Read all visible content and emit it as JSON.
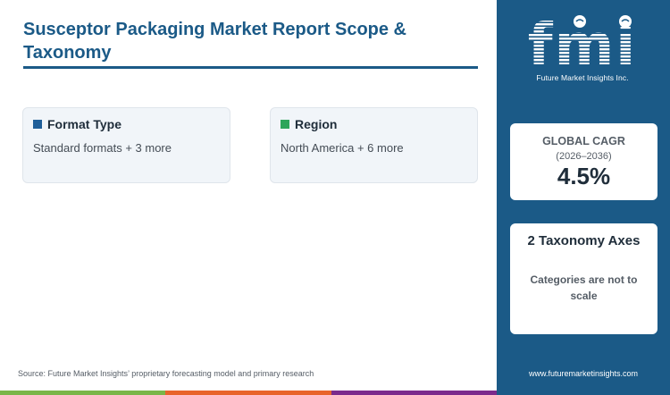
{
  "header": {
    "title": "Susceptor Packaging Market Report Scope & Taxonomy"
  },
  "cards": [
    {
      "title": "Format Type",
      "value": "Standard formats + 3 more",
      "color": "#1f5f99"
    },
    {
      "title": "Region",
      "value": "North America + 6 more",
      "color": "#2ea55a"
    }
  ],
  "footer": {
    "source": "Source: Future Market Insights’ proprietary forecasting model and primary research",
    "bar_colors": [
      "#7ab648",
      "#e8642a",
      "#7b2a8c"
    ]
  },
  "sidebar": {
    "logo_text": "fmi",
    "logo_subtitle": "Future Market Insights Inc.",
    "cagr": {
      "label": "GLOBAL CAGR",
      "range": "(2026–2036)",
      "value": "4.5%"
    },
    "axes": {
      "title": "2 Taxonomy Axes",
      "note": "Categories are not to scale"
    },
    "url": "www.futuremarketinsights.com"
  },
  "colors": {
    "brand": "#1b5a87"
  }
}
